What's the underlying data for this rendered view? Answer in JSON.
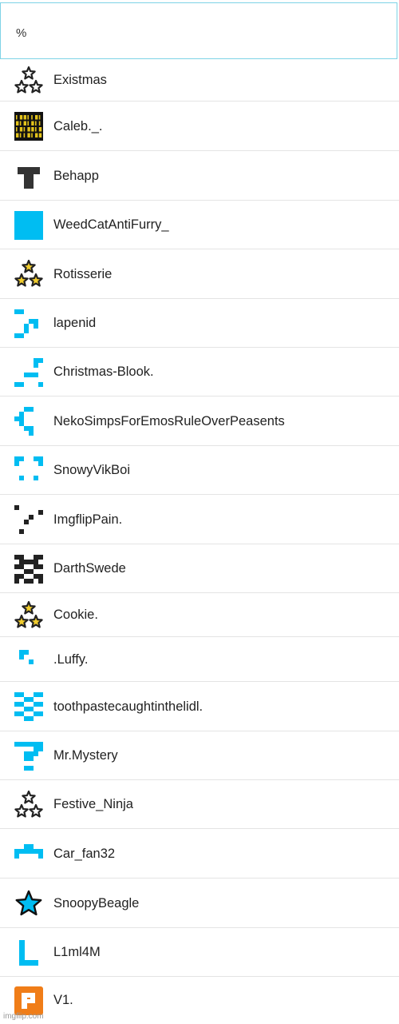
{
  "search": {
    "value": "%"
  },
  "users": [
    {
      "name": "Existmas",
      "avatar": "stars-trio-icon"
    },
    {
      "name": "Caleb._.",
      "avatar": "binary-matrix-icon"
    },
    {
      "name": "Behapp",
      "avatar": "dark-tshirt-icon"
    },
    {
      "name": "WeedCatAntiFurry_",
      "avatar": "blue-square-icon"
    },
    {
      "name": "Rotisserie",
      "avatar": "stars-trio-gold-icon"
    },
    {
      "name": "lapenid",
      "avatar": "identicon-icon"
    },
    {
      "name": "Christmas-Blook.",
      "avatar": "identicon-icon"
    },
    {
      "name": "NekoSimpsForEmosRuleOverPeasents",
      "avatar": "identicon-icon"
    },
    {
      "name": "SnowyVikBoi",
      "avatar": "identicon-icon"
    },
    {
      "name": "ImgflipPain.",
      "avatar": "identicon-dark-icon"
    },
    {
      "name": "DarthSwede",
      "avatar": "checkered-x-icon"
    },
    {
      "name": "Cookie.",
      "avatar": "stars-trio-gold-icon"
    },
    {
      "name": ".Luffy.",
      "avatar": "identicon-icon"
    },
    {
      "name": "toothpastecaughtinthelidl.",
      "avatar": "identicon-icon"
    },
    {
      "name": "Mr.Mystery",
      "avatar": "identicon-icon"
    },
    {
      "name": "Festive_Ninja",
      "avatar": "stars-trio-icon"
    },
    {
      "name": "Car_fan32",
      "avatar": "identicon-icon"
    },
    {
      "name": "SnoopyBeagle",
      "avatar": "blue-star-icon"
    },
    {
      "name": "L1ml4M",
      "avatar": "letter-l-icon"
    },
    {
      "name": "V1.",
      "avatar": "orange-square-icon"
    }
  ],
  "watermark": "imgflip.com",
  "colors": {
    "accent_blue": "#00bdf2",
    "orange": "#f07d18",
    "gold": "#e8c32a",
    "dark": "#222222"
  }
}
